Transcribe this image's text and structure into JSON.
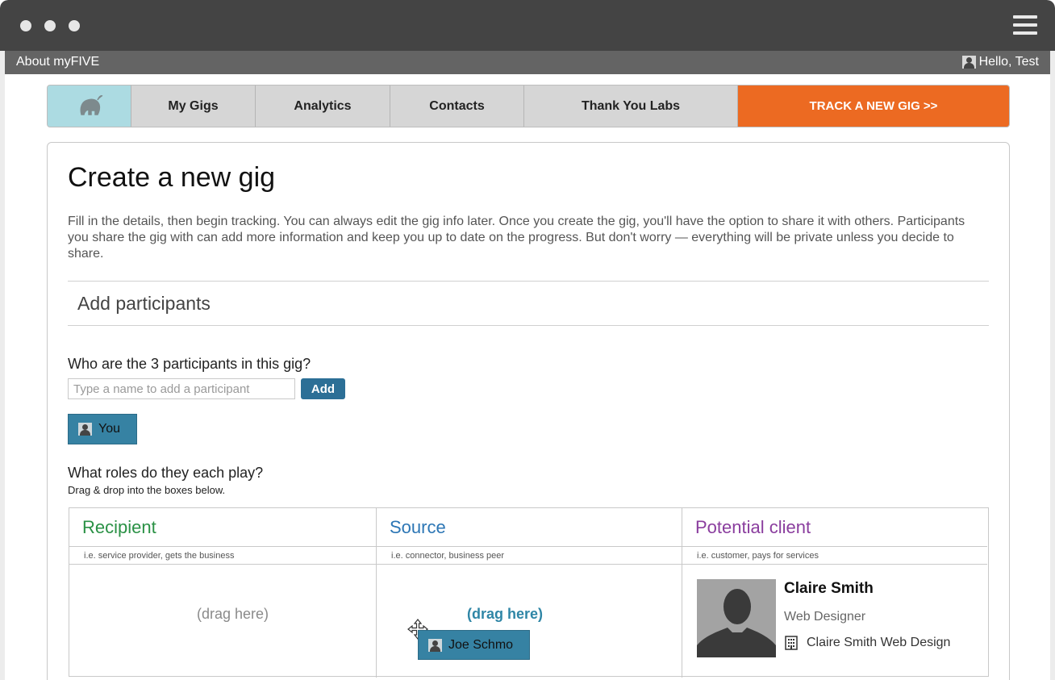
{
  "window": {
    "controls": [
      "dot",
      "dot",
      "dot"
    ],
    "menu_icon": "hamburger-icon"
  },
  "topbar": {
    "about_label": "About myFIVE",
    "greeting": "Hello, Test",
    "user_icon": "user-icon"
  },
  "nav": {
    "logo_icon": "elephant-logo",
    "tabs": [
      {
        "label": "My Gigs"
      },
      {
        "label": "Analytics"
      },
      {
        "label": "Contacts"
      },
      {
        "label": "Thank You Labs"
      }
    ],
    "cta_label": "TRACK A NEW GIG >>",
    "cta_color": "#ec6a22"
  },
  "page": {
    "title": "Create a new gig",
    "intro": "Fill in the details, then begin tracking. You can always edit the gig info later. Once you create the gig, you'll have the option to share it with others. Participants you share the gig with can add more information and keep you up to date on the progress. But don't worry — everything will be private unless you decide to share."
  },
  "participants": {
    "heading": "Add participants",
    "question": "Who are the 3 participants in this gig?",
    "input_placeholder": "Type a name to add a participant",
    "input_value": "",
    "add_label": "Add",
    "chips": [
      {
        "label": "You"
      }
    ]
  },
  "roles": {
    "question": "What roles do they each play?",
    "hint": "Drag & drop into the boxes below.",
    "columns": [
      {
        "title": "Recipient",
        "color": "#2a9145",
        "hint": "i.e. service provider, gets the business",
        "placeholder": "(drag here)"
      },
      {
        "title": "Source",
        "color": "#2c76b5",
        "hint": "i.e. connector, business peer",
        "placeholder": "(drag here)"
      },
      {
        "title": "Potential client",
        "color": "#8a3d9e",
        "hint": "i.e. customer, pays for services"
      }
    ],
    "dragging_chip": "Joe Schmo",
    "assigned_card": {
      "name": "Claire Smith",
      "role": "Web Designer",
      "company": "Claire Smith Web Design",
      "company_icon": "building-icon"
    }
  }
}
